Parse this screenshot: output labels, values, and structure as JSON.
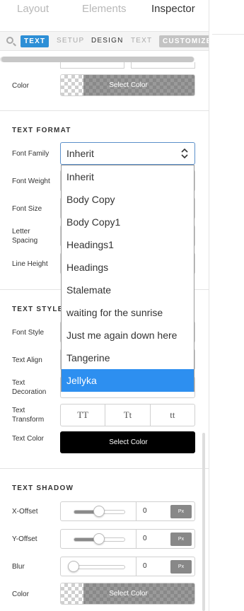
{
  "top_tabs": [
    {
      "label": "Layout"
    },
    {
      "label": "Elements"
    },
    {
      "label": "Inspector"
    }
  ],
  "subtabs": [
    {
      "label": "TEXT"
    },
    {
      "label": "SETUP"
    },
    {
      "label": "DESIGN"
    },
    {
      "label": "TEXT"
    },
    {
      "label": "CUSTOMIZE"
    }
  ],
  "top_section": {
    "color_label": "Color",
    "color_button": "Select Color"
  },
  "text_format": {
    "title": "TEXT FORMAT",
    "font_family_label": "Font Family",
    "font_family_value": "Inherit",
    "font_weight_label": "Font Weight",
    "font_size_label": "Font Size",
    "letter_spacing_label": "Letter Spacing",
    "line_height_label": "Line Height",
    "dropdown_options": [
      "Inherit",
      "Body Copy",
      "Body Copy1",
      "Headings1",
      "Headings",
      "Stalemate",
      "waiting for the sunrise",
      "Just me again down here",
      "Tangerine",
      "Jellyka"
    ],
    "highlighted_option": "Jellyka"
  },
  "text_style": {
    "title": "TEXT STYLE",
    "font_style_label": "Font Style",
    "text_align_label": "Text Align",
    "text_decoration_label": "Text Decoration",
    "text_transform_label": "Text Transform",
    "transform_options": [
      "TT",
      "Tt",
      "tt"
    ],
    "text_color_label": "Text Color",
    "text_color_button": "Select Color",
    "text_color_value": "#000000"
  },
  "text_shadow": {
    "title": "TEXT SHADOW",
    "x_offset_label": "X-Offset",
    "x_offset_value": "0",
    "x_offset_unit": "Px",
    "x_offset_slider": 0.5,
    "y_offset_label": "Y-Offset",
    "y_offset_value": "0",
    "y_offset_unit": "Px",
    "y_offset_slider": 0.5,
    "blur_label": "Blur",
    "blur_value": "0",
    "blur_unit": "Px",
    "blur_slider": 0.0,
    "color_label": "Color",
    "color_button": "Select Color"
  },
  "colors": {
    "accent": "#2d8fd6",
    "selected_option": "#2d8ff0"
  }
}
